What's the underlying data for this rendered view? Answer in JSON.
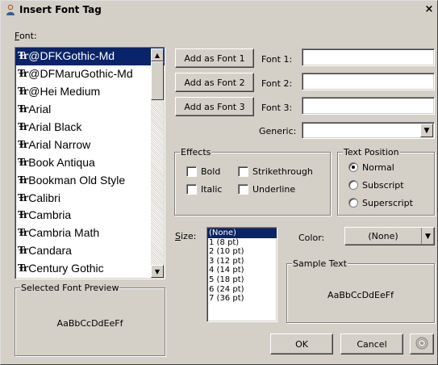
{
  "window": {
    "title": "Insert Font Tag",
    "close_label": "×"
  },
  "font_section": {
    "label": "Font:",
    "fonts": [
      {
        "name": "@DFKGothic-Md",
        "selected": true
      },
      {
        "name": "@DFMaruGothic-Md",
        "selected": false
      },
      {
        "name": "@Hei Medium",
        "selected": false
      },
      {
        "name": "Arial",
        "selected": false
      },
      {
        "name": "Arial Black",
        "selected": false
      },
      {
        "name": "Arial Narrow",
        "selected": false
      },
      {
        "name": "Book Antiqua",
        "selected": false
      },
      {
        "name": "Bookman Old Style",
        "selected": false
      },
      {
        "name": "Calibri",
        "selected": false
      },
      {
        "name": "Cambria",
        "selected": false
      },
      {
        "name": "Cambria Math",
        "selected": false
      },
      {
        "name": "Candara",
        "selected": false
      },
      {
        "name": "Century Gothic",
        "selected": false
      }
    ],
    "truetype_glyph": "Ŧr"
  },
  "preview": {
    "group_label": "Selected Font Preview",
    "sample": "AaBbCcDdEeFf"
  },
  "font_slots": [
    {
      "button_label": "Add as Font 1",
      "field_label": "Font 1:",
      "value": ""
    },
    {
      "button_label": "Add as Font 2",
      "field_label": "Font 2:",
      "value": ""
    },
    {
      "button_label": "Add as Font 3",
      "field_label": "Font 3:",
      "value": ""
    }
  ],
  "generic": {
    "label": "Generic:",
    "value": ""
  },
  "effects": {
    "group_label": "Effects",
    "bold": {
      "label": "Bold",
      "checked": false
    },
    "italic": {
      "label": "Italic",
      "checked": false
    },
    "strikethrough": {
      "label": "Strikethrough",
      "checked": false
    },
    "underline": {
      "label": "Underline",
      "checked": false
    }
  },
  "text_position": {
    "group_label": "Text Position",
    "options": [
      {
        "label": "Normal",
        "checked": true
      },
      {
        "label": "Subscript",
        "checked": false
      },
      {
        "label": "Superscript",
        "checked": false
      }
    ]
  },
  "size": {
    "label": "Size:",
    "options": [
      "(None)",
      "1 (8 pt)",
      "2 (10 pt)",
      "3 (12 pt)",
      "4 (14 pt)",
      "5 (18 pt)",
      "6 (24 pt)",
      "7 (36 pt)"
    ],
    "selected_index": 0
  },
  "color": {
    "label": "Color:",
    "value": "(None)"
  },
  "sample_text": {
    "group_label": "Sample Text",
    "sample": "AaBbCcDdEeFf"
  },
  "buttons": {
    "ok": "OK",
    "cancel": "Cancel"
  },
  "icons": {
    "title": "user-icon",
    "help": "help-icon"
  }
}
